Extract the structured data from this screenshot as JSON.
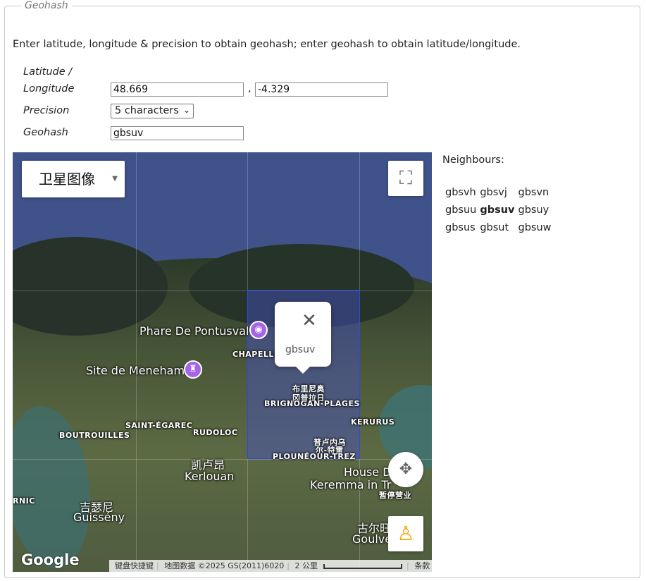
{
  "legend": "Geohash",
  "intro": "Enter latitude, longitude & precision to obtain geohash; enter geohash to obtain latitude/longitude.",
  "form": {
    "latlon_label_line1": "Latitude /",
    "latlon_label_line2": "Longitude",
    "latitude": "48.669",
    "separator": ",",
    "longitude": "-4.329",
    "precision_label": "Precision",
    "precision_value": "5 characters",
    "geohash_label": "Geohash",
    "geohash": "gbsuv"
  },
  "map": {
    "map_type": "卫星图像",
    "popup_text": "gbsuv",
    "labels": {
      "phare": "Phare De Pontusval",
      "meneham": "Site de Meneham",
      "chapelle": "CHAPELLE",
      "brignogan_cn1": "布里尼奥",
      "brignogan_cn2": "冈普拉日",
      "brignogan": "BRIGNOGAN-PLAGES",
      "saint_egarec": "SAINT-ÉGAREC",
      "rudoloc": "RUDOLOC",
      "boutrouilles": "BOUTROUILLES",
      "kerurus": "KERURUS",
      "plouneour_cn1": "普卢内乌",
      "plouneour_cn2": "尔-特雷",
      "plouneour": "PLOUNÉOUR-TREZ",
      "kerlouan_cn": "凯卢昂",
      "kerlouan": "Kerlouan",
      "house": "House D",
      "keremma": "Keremma in Tr",
      "zanting": "暂停营业",
      "rnic": "RNIC",
      "guisseny_cn": "吉瑟尼",
      "guisseny": "Guissény",
      "goulven_cn": "古尔旺",
      "goulven": "Goulve"
    },
    "logo": "Google",
    "attribution": {
      "shortcuts": "键盘快捷键",
      "data": "地图数据 ©2025 GS(2011)6020",
      "scale": "2 公里",
      "terms": "条款"
    }
  },
  "neighbours": {
    "title": "Neighbours:",
    "grid": [
      [
        "gbsvh",
        "gbsvj",
        "gbsvn"
      ],
      [
        "gbsuu",
        "gbsuv",
        "gbsuy"
      ],
      [
        "gbsus",
        "gbsut",
        "gbsuw"
      ]
    ]
  },
  "colors": {
    "geohash_cell": "#3346e0",
    "poi_pin": "#a665e6",
    "pegman": "#f3a900"
  }
}
